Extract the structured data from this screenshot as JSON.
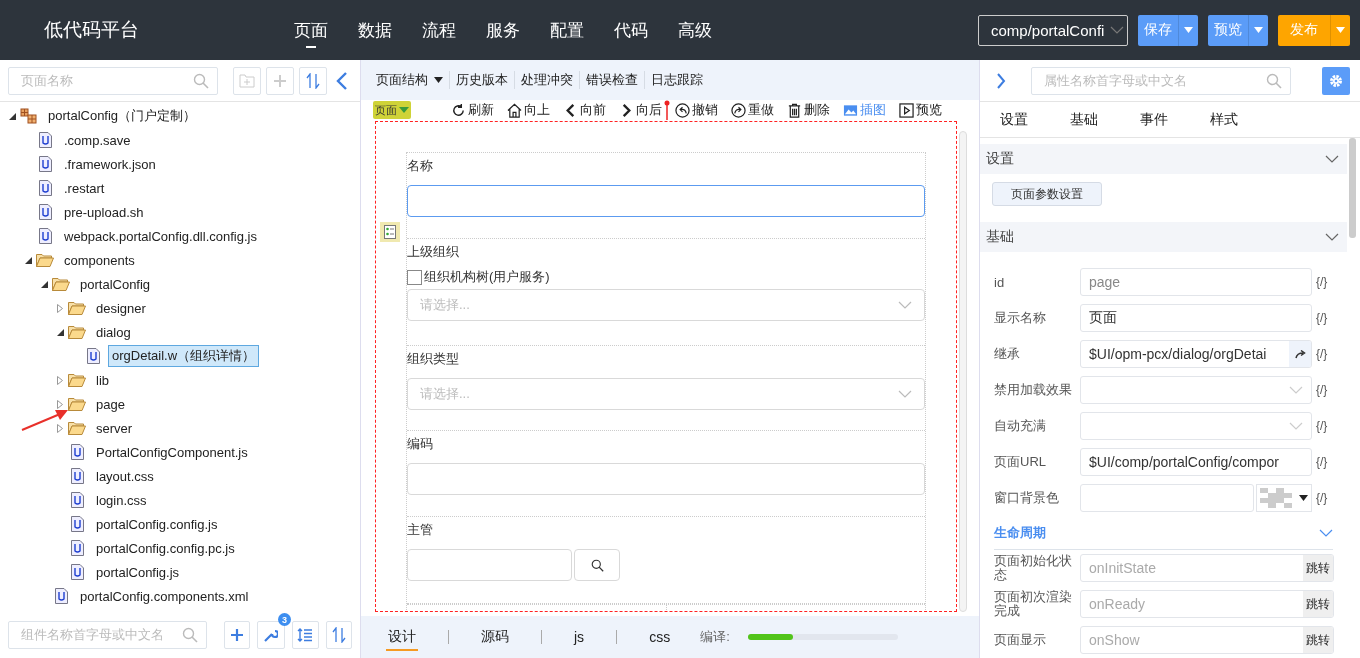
{
  "header": {
    "title": "低代码平台",
    "nav": [
      {
        "label": "页面",
        "selected": true
      },
      {
        "label": "数据",
        "selected": false
      },
      {
        "label": "流程",
        "selected": false
      },
      {
        "label": "服务",
        "selected": false
      },
      {
        "label": "配置",
        "selected": false
      },
      {
        "label": "代码",
        "selected": false
      },
      {
        "label": "高级",
        "selected": false
      }
    ],
    "path_select": "comp/portalConfi",
    "buttons": [
      {
        "label": "保存",
        "kind": "primary"
      },
      {
        "label": "预览",
        "kind": "primary"
      },
      {
        "label": "发布",
        "kind": "publish"
      }
    ]
  },
  "left_panel": {
    "search": {
      "placeholder": "页面名称"
    },
    "tree": [
      {
        "kind": "project",
        "label": "portalConfig（门户定制）",
        "expanded": true,
        "selected": false,
        "children": [
          {
            "kind": "file",
            "label": ".comp.save",
            "selected": false
          },
          {
            "kind": "file",
            "label": ".framework.json",
            "selected": false
          },
          {
            "kind": "file",
            "label": ".restart",
            "selected": false
          },
          {
            "kind": "file",
            "label": "pre-upload.sh",
            "selected": false
          },
          {
            "kind": "file",
            "label": "webpack.portalConfig.dll.config.js",
            "selected": false
          },
          {
            "kind": "folder",
            "label": "components",
            "expanded": true,
            "selected": false,
            "children": [
              {
                "kind": "folder",
                "label": "portalConfig",
                "expanded": true,
                "selected": false,
                "children": [
                  {
                    "kind": "folder",
                    "label": "designer",
                    "expanded": false,
                    "selected": false
                  },
                  {
                    "kind": "folder",
                    "label": "dialog",
                    "expanded": true,
                    "selected": false,
                    "children": [
                      {
                        "kind": "file",
                        "label": "orgDetail.w（组织详情）",
                        "selected": true
                      }
                    ]
                  },
                  {
                    "kind": "folder",
                    "label": "lib",
                    "expanded": false,
                    "selected": false
                  },
                  {
                    "kind": "folder",
                    "label": "page",
                    "expanded": false,
                    "selected": false
                  },
                  {
                    "kind": "folder",
                    "label": "server",
                    "expanded": false,
                    "selected": false
                  },
                  {
                    "kind": "file",
                    "label": "PortalConfigComponent.js",
                    "selected": false
                  },
                  {
                    "kind": "file",
                    "label": "layout.css",
                    "selected": false
                  },
                  {
                    "kind": "file",
                    "label": "login.css",
                    "selected": false
                  },
                  {
                    "kind": "file",
                    "label": "portalConfig.config.js",
                    "selected": false
                  },
                  {
                    "kind": "file",
                    "label": "portalConfig.config.pc.js",
                    "selected": false
                  },
                  {
                    "kind": "file",
                    "label": "portalConfig.js",
                    "selected": false
                  }
                ]
              },
              {
                "kind": "file",
                "label": "portalConfig.components.xml",
                "selected": false
              }
            ]
          }
        ]
      }
    ],
    "component_search": {
      "placeholder": "组件名称首字母或中文名"
    },
    "tools_badge": "3"
  },
  "center": {
    "toolbar": [
      {
        "label": "页面结构",
        "dropdown": true
      },
      {
        "label": "历史版本",
        "dropdown": false
      },
      {
        "label": "处理冲突",
        "dropdown": false
      },
      {
        "label": "错误检查",
        "dropdown": false
      },
      {
        "label": "日志跟踪",
        "dropdown": false
      }
    ],
    "element_tag": "页面",
    "actions": [
      {
        "kind": "refresh",
        "label": "刷新",
        "active": false
      },
      {
        "kind": "up",
        "label": "向上",
        "active": false
      },
      {
        "kind": "back",
        "label": "向前",
        "active": false
      },
      {
        "kind": "forward",
        "label": "向后",
        "active": false
      },
      {
        "kind": "undo",
        "label": "撤销",
        "active": false
      },
      {
        "kind": "redo",
        "label": "重做",
        "active": false
      },
      {
        "kind": "delete",
        "label": "删除",
        "active": false
      },
      {
        "kind": "image",
        "label": "插图",
        "active": true
      },
      {
        "kind": "preview",
        "label": "预览",
        "active": false
      }
    ],
    "form": [
      {
        "kind": "input",
        "label": "名称",
        "focused": true
      },
      {
        "kind": "tree-select",
        "label": "上级组织",
        "checkbox_label": "组织机构树(用户服务)",
        "checked": false,
        "placeholder": "请选择..."
      },
      {
        "kind": "select",
        "label": "组织类型",
        "placeholder": "请选择..."
      },
      {
        "kind": "input",
        "label": "编码",
        "focused": false
      },
      {
        "kind": "search",
        "label": "主管"
      }
    ],
    "bottom_tabs": [
      {
        "label": "设计",
        "selected": true
      },
      {
        "label": "源码",
        "selected": false
      },
      {
        "label": "js",
        "selected": false
      },
      {
        "label": "css",
        "selected": false
      }
    ],
    "compile": {
      "label": "编译:",
      "level": 0.3
    }
  },
  "right_panel": {
    "search": {
      "placeholder": "属性名称首字母或中文名"
    },
    "tabs": [
      "设置",
      "基础",
      "事件",
      "样式"
    ],
    "settings_section": {
      "title": "设置",
      "expanded": true,
      "button": "页面参数设置"
    },
    "basic_section": {
      "title": "基础",
      "expanded": true,
      "properties": [
        {
          "kind": "text",
          "label": "id",
          "placeholder": "page"
        },
        {
          "kind": "text",
          "label": "显示名称",
          "value": "页面"
        },
        {
          "kind": "link",
          "label": "继承",
          "value": "$UI/opm-pcx/dialog/orgDetai"
        },
        {
          "kind": "select",
          "label": "禁用加载效果"
        },
        {
          "kind": "select",
          "label": "自动充满"
        },
        {
          "kind": "text",
          "label": "页面URL",
          "value": "$UI/comp/portalConfig/compor"
        },
        {
          "kind": "color",
          "label": "窗口背景色"
        }
      ],
      "expression_mark": "{/}"
    },
    "lifecycle": {
      "title": "生命周期",
      "expanded": true,
      "events": [
        {
          "label": "页面初始化状态",
          "placeholder": "onInitState",
          "button": "跳转"
        },
        {
          "label": "页面初次渲染完成",
          "placeholder": "onReady",
          "button": "跳转"
        },
        {
          "label": "页面显示",
          "placeholder": "onShow",
          "button": "跳转"
        }
      ]
    }
  }
}
